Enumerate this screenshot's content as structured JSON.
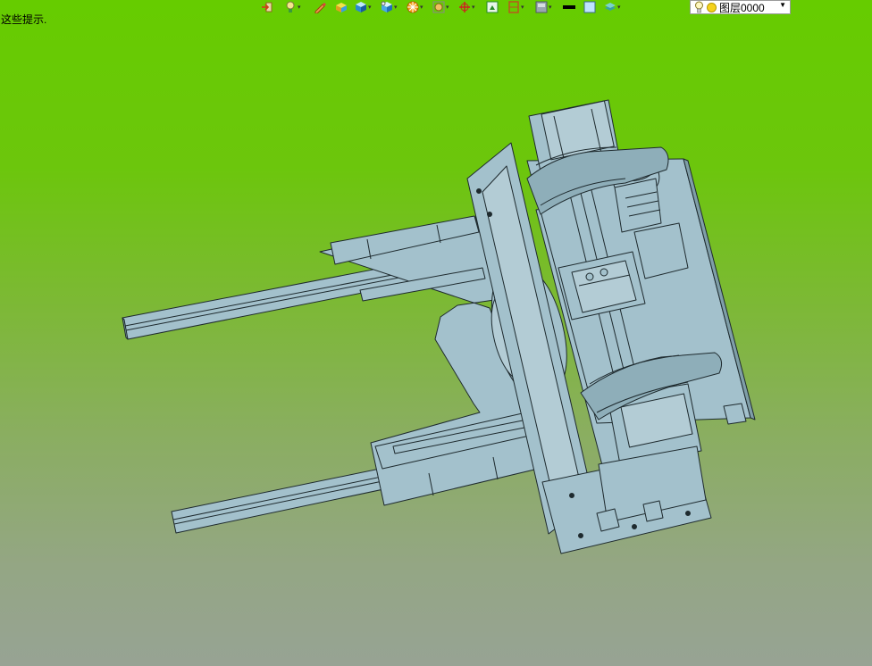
{
  "status_hint": "这些提示.",
  "layer_select": {
    "value": "图层0000"
  },
  "toolbar_icons": [
    "import-icon",
    "lamp-icon",
    "pencil-icon",
    "solid-box-icon",
    "view-cube-icon",
    "render-cube-icon",
    "wheel-icon",
    "zoom-fit-icon",
    "rotate-axis-icon",
    "fit-view-icon",
    "section-view-icon",
    "display-mode-icon",
    "line-color-icon",
    "fill-color-icon",
    "layer-icon"
  ],
  "colors": {
    "background_top": "#66cc00",
    "background_bottom": "#97a394",
    "model_fill": "#a3c1cc",
    "model_edge": "#1e2a2e"
  }
}
